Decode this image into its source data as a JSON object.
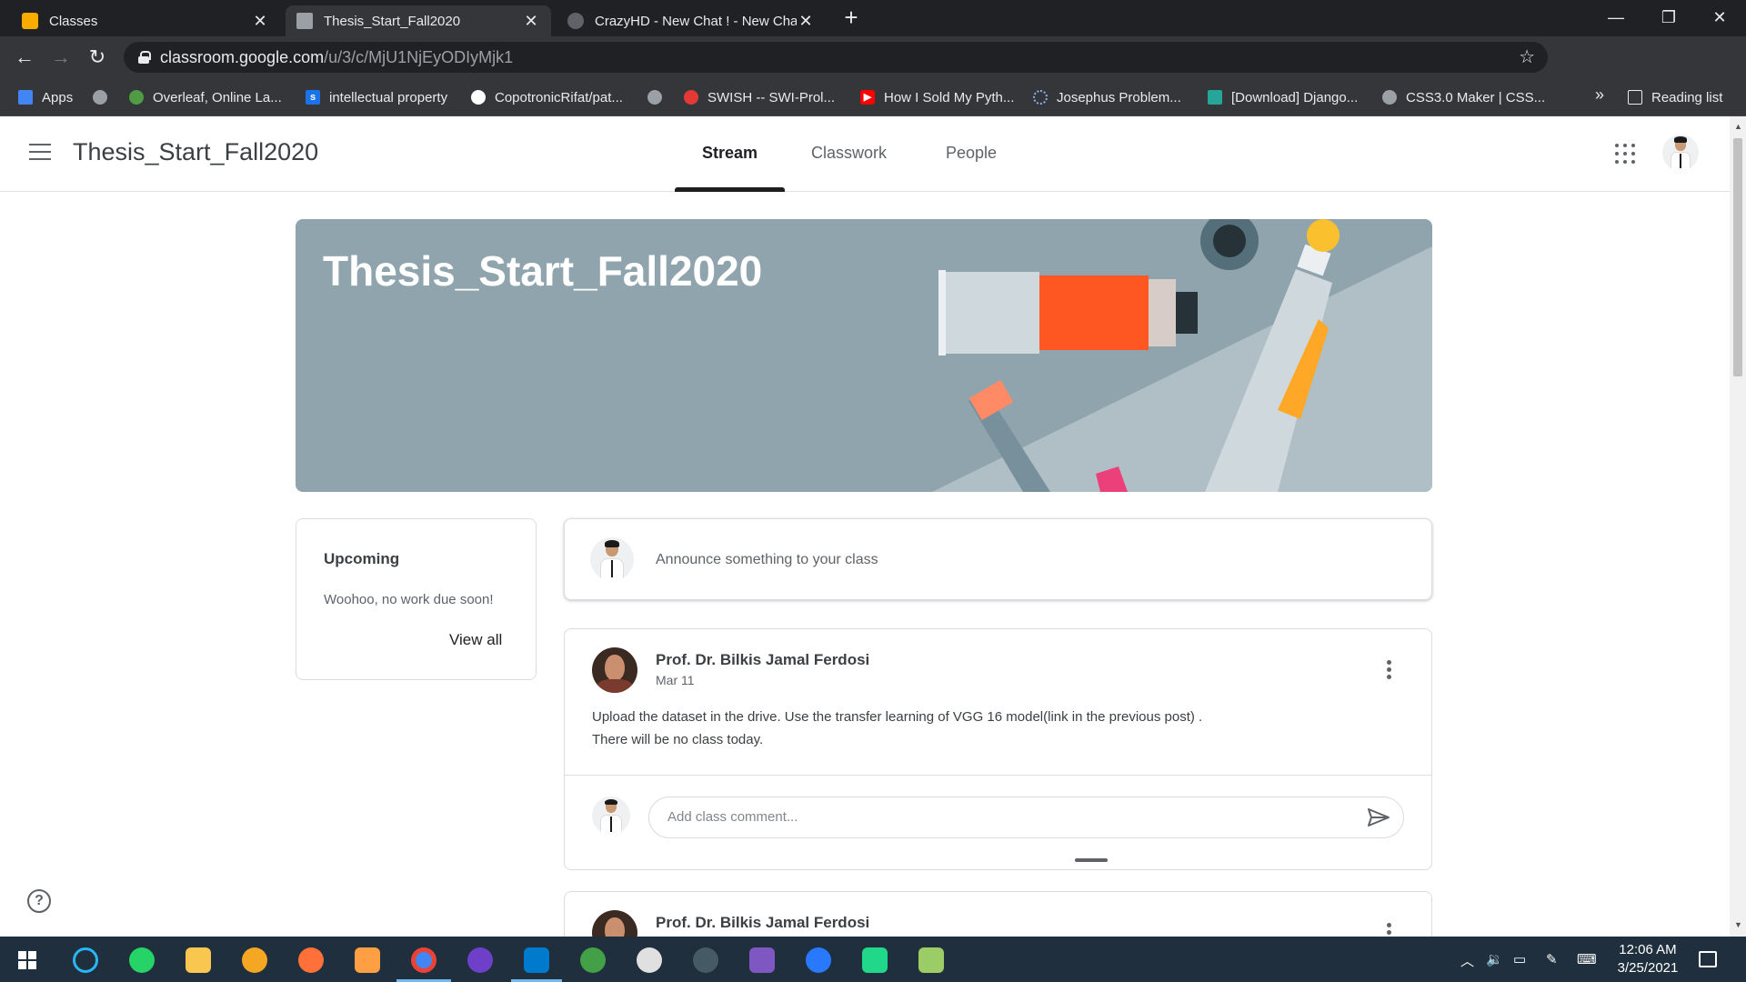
{
  "browser": {
    "tabs": [
      {
        "title": "Classes",
        "favicon_color": "#f9ab00"
      },
      {
        "title": "Thesis_Start_Fall2020",
        "favicon_color": "#9aa0a6",
        "active": true
      },
      {
        "title": "CrazyHD - New Chat ! - New Cha",
        "favicon_color": "#5f6368"
      }
    ],
    "new_tab": "+",
    "window_controls": {
      "minimize": "—",
      "restore": "❐",
      "close": "✕"
    },
    "address": {
      "host": "classroom.google.com",
      "path": "/u/3/c/MjU1NjEyODIyMjk1"
    },
    "bookmarks": [
      {
        "label": "Apps",
        "icon": "apps-grid-icon",
        "color": "#4285f4"
      },
      {
        "label": "",
        "icon": "globe-icon",
        "color": "#9aa0a6"
      },
      {
        "label": "Overleaf, Online La...",
        "icon": "overleaf-icon",
        "color": "#4f9c45"
      },
      {
        "label": "intellectual property",
        "icon": "s-icon",
        "color": "#1a73e8"
      },
      {
        "label": "CopotronicRifat/pat...",
        "icon": "github-icon",
        "color": "#ffffff"
      },
      {
        "label": "",
        "icon": "globe-icon",
        "color": "#9aa0a6"
      },
      {
        "label": "SWISH -- SWI-Prol...",
        "icon": "swish-icon",
        "color": "#e53935"
      },
      {
        "label": "How I Sold My Pyth...",
        "icon": "youtube-icon",
        "color": "#ff0000"
      },
      {
        "label": "Josephus Problem...",
        "icon": "loading-icon",
        "color": "#8ab4f8"
      },
      {
        "label": "[Download] Django...",
        "icon": "site-icon",
        "color": "#26a69a"
      },
      {
        "label": "CSS3.0 Maker | CSS...",
        "icon": "globe-icon",
        "color": "#9aa0a6"
      }
    ],
    "bookmarks_more": "»",
    "reading_list": "Reading list"
  },
  "classroom": {
    "class_title": "Thesis_Start_Fall2020",
    "nav_tabs": [
      "Stream",
      "Classwork",
      "People"
    ],
    "banner_title": "Thesis_Start_Fall2020",
    "banner_color": "#90a4ae",
    "upcoming": {
      "title": "Upcoming",
      "message": "Woohoo, no work due soon!",
      "view_all": "View all"
    },
    "announce_placeholder": "Announce something to your class",
    "posts": [
      {
        "author": "Prof. Dr. Bilkis Jamal Ferdosi",
        "date": "Mar 11",
        "body_line1": "Upload the dataset in the drive. Use the transfer learning of VGG 16 model(link in the previous post) .",
        "body_line2": "There will be no class today.",
        "comment_placeholder": "Add class comment..."
      },
      {
        "author": "Prof. Dr. Bilkis Jamal Ferdosi"
      }
    ],
    "help": "?"
  },
  "taskbar": {
    "time": "12:06 AM",
    "date": "3/25/2021"
  }
}
